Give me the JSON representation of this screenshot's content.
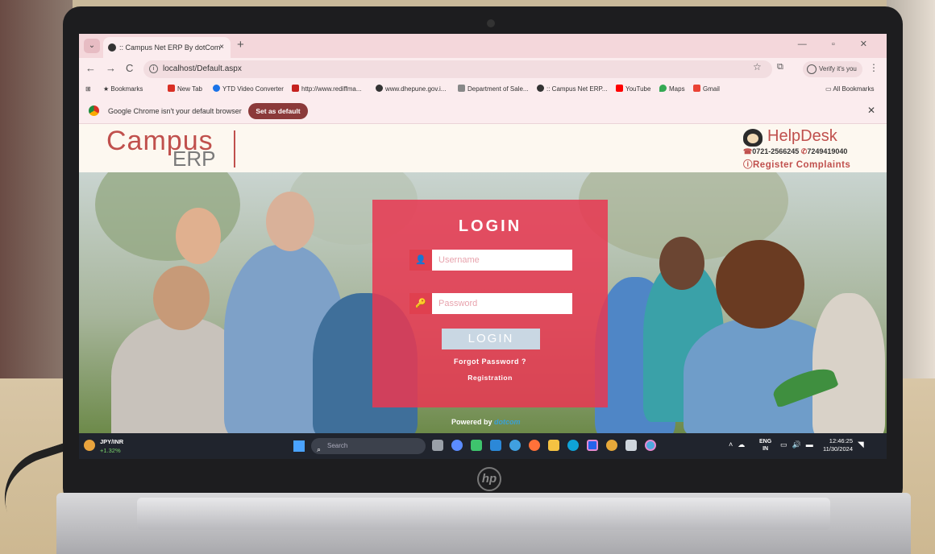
{
  "browser": {
    "tab_title": ":: Campus Net ERP By dotCom",
    "tab_close": "×",
    "new_tab": "+",
    "window_controls": "—  ▫  ✕",
    "url": "localhost/Default.aspx",
    "profile_label": "Verify it's you",
    "bookmarks": [
      "Bookmarks",
      "New Tab",
      "YTD Video Converter",
      "http://www.rediffma...",
      "www.dhepune.gov.i...",
      "Department of Sale...",
      ":: Campus Net ERP...",
      "YouTube",
      "Maps",
      "Gmail",
      "All Bookmarks"
    ],
    "infobar_text": "Google Chrome isn't your default browser",
    "set_default_label": "Set as default",
    "colors": {
      "tabstrip": "#f4d7db",
      "toolbar": "#fbecee",
      "set_default": "#8b3a3a"
    }
  },
  "erp": {
    "logo_campus": "Campus",
    "logo_erp": "ERP",
    "helpdesk_title": "HelpDesk",
    "phone_1": "0721-2566245",
    "phone_2": "7249419040",
    "register_complaints": "Register Complaints",
    "colors": {
      "brand_red": "#c0504d",
      "register_blue": "#1e3a8a"
    }
  },
  "login": {
    "title": "LOGIN",
    "username_placeholder": "Username",
    "password_placeholder": "Password",
    "button_label": "LOGIN",
    "forgot_password": "Forgot Password ?",
    "registration": "Registration",
    "powered_by": "Powered by",
    "powered_brand": "dotcom",
    "colors": {
      "panel": "#e83852",
      "button": "#c9d7e3"
    }
  },
  "taskbar": {
    "ticker_name": "JPY/INR",
    "ticker_change": "+1.32%",
    "search_placeholder": "Search",
    "lang_top": "ENG",
    "lang_bottom": "IN",
    "time": "12:46:25",
    "date": "11/30/2024"
  }
}
